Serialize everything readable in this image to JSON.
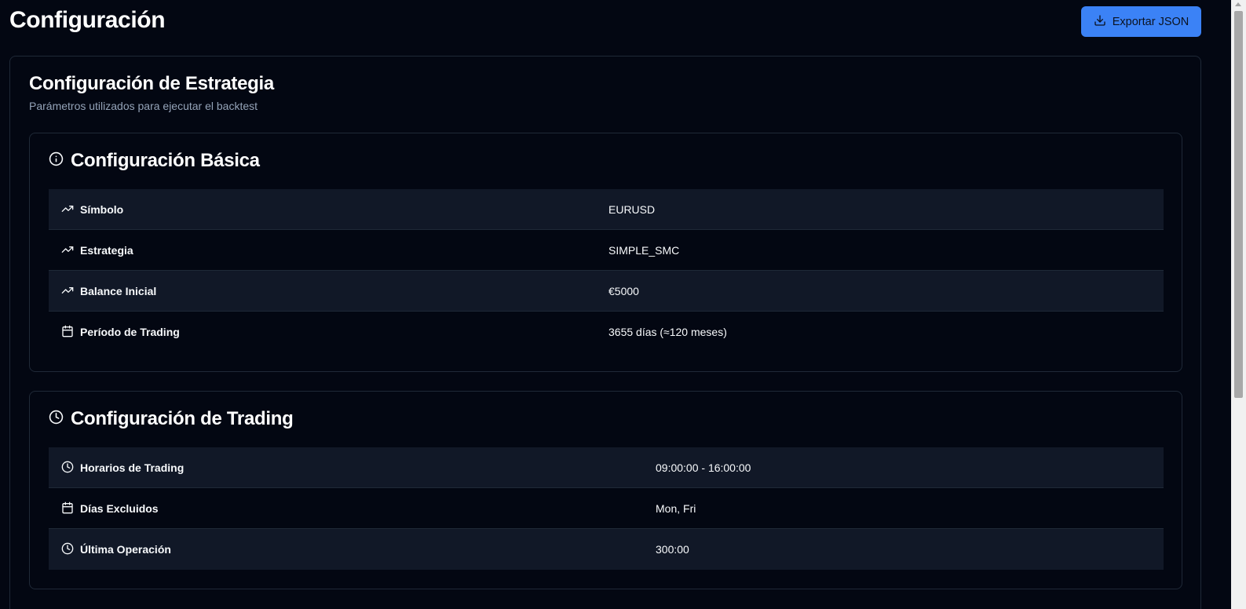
{
  "header": {
    "title": "Configuración",
    "export_label": "Exportar JSON",
    "export_icon": "download-icon"
  },
  "strategy_card": {
    "title": "Configuración de Estrategia",
    "subtitle": "Parámetros utilizados para ejecutar el backtest"
  },
  "basic": {
    "title": "Configuración Básica",
    "icon": "info-icon",
    "rows": [
      {
        "label": "Símbolo",
        "value": "EURUSD",
        "icon": "trending-up-icon"
      },
      {
        "label": "Estrategia",
        "value": "SIMPLE_SMC",
        "icon": "trending-up-icon"
      },
      {
        "label": "Balance Inicial",
        "value": "€5000",
        "icon": "trending-up-icon"
      },
      {
        "label": "Período de Trading",
        "value": "3655 días (≈120 meses)",
        "icon": "calendar-icon"
      }
    ]
  },
  "trading": {
    "title": "Configuración de Trading",
    "icon": "clock-icon",
    "rows": [
      {
        "label": "Horarios de Trading",
        "value": "09:00:00 - 16:00:00",
        "icon": "clock-icon"
      },
      {
        "label": "Días Excluidos",
        "value": "Mon, Fri",
        "icon": "calendar-icon"
      },
      {
        "label": "Última Operación",
        "value": "300:00",
        "icon": "clock-icon"
      }
    ]
  },
  "colors": {
    "background": "#030712",
    "row_alt": "#111827",
    "border": "#1f2937",
    "accent": "#3b82f6",
    "subtitle": "#94a3b8"
  }
}
